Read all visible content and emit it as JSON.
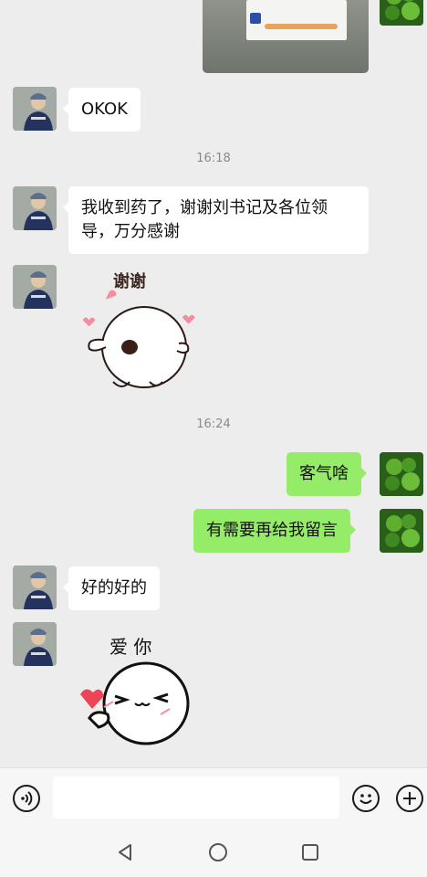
{
  "messages": {
    "okok": "OKOK",
    "time1": "16:18",
    "received_medicine": "我收到药了，谢谢刘书记及各位领导，万分感谢",
    "sticker1_text": "谢谢",
    "time2": "16:24",
    "you_are_welcome": "客气啥",
    "leave_message": "有需要再给我留言",
    "ok_ok": "好的好的",
    "sticker2_text": "爱 你"
  },
  "icons": {
    "voice": "voice-icon",
    "emoji": "emoji-icon",
    "plus": "plus-icon",
    "back": "nav-back-icon",
    "home": "nav-home-icon",
    "recents": "nav-recents-icon"
  },
  "colors": {
    "background": "#ededed",
    "sent_bubble": "#95ec69",
    "received_bubble": "#ffffff"
  }
}
